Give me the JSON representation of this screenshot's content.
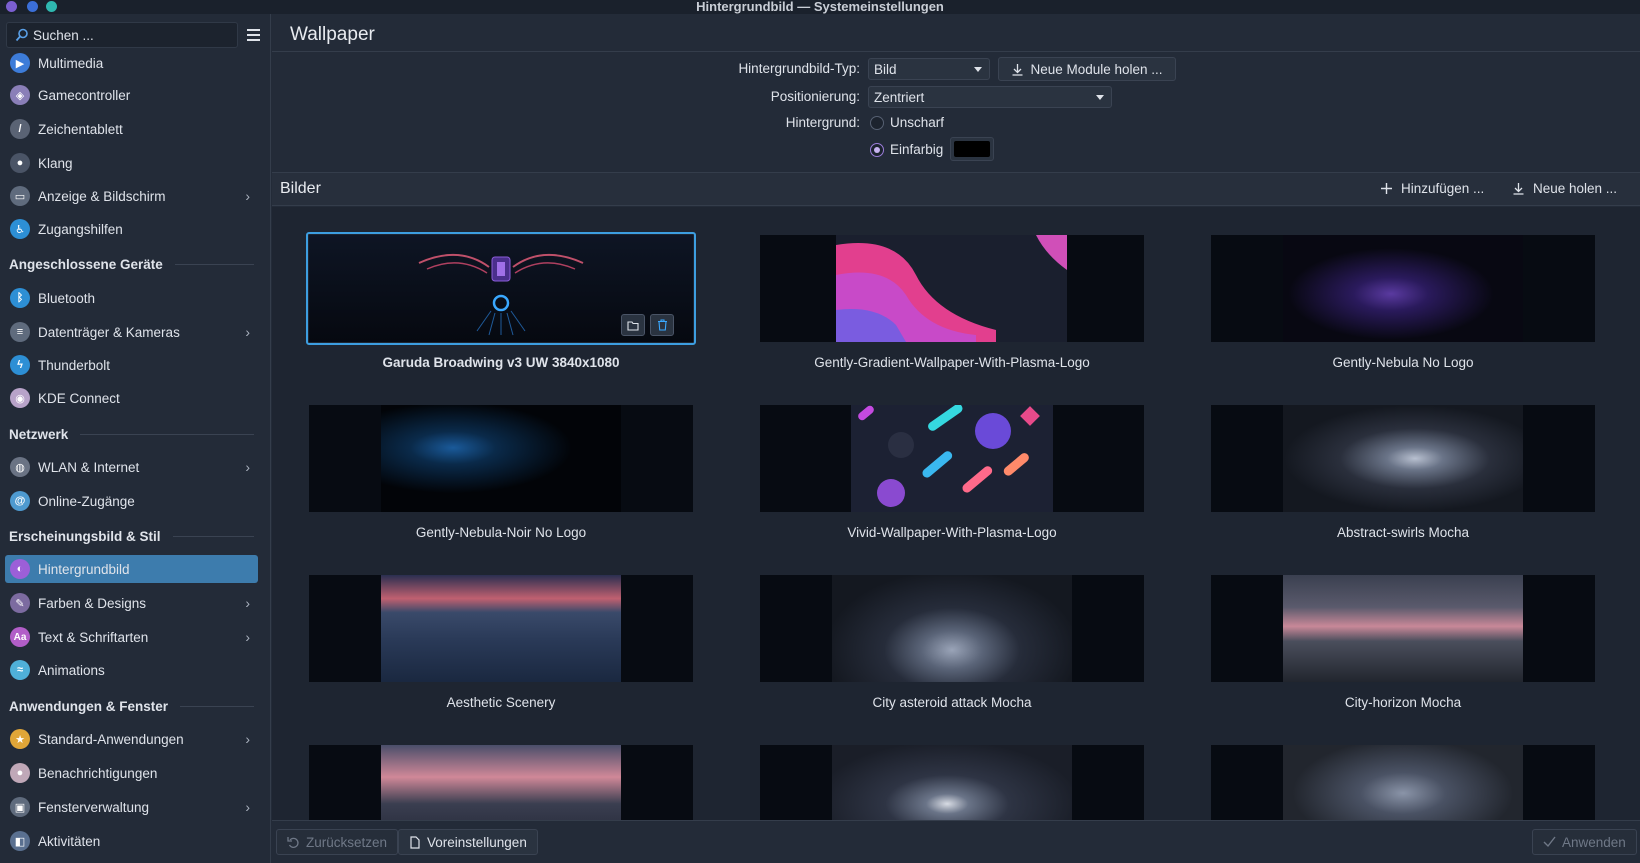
{
  "window": {
    "title": "Hintergrundbild — Systemeinstellungen"
  },
  "sidebar": {
    "search_placeholder": "Suchen ...",
    "items": [
      {
        "label": "Multimedia",
        "icon": "multimedia-icon",
        "color": "#3d7cd9"
      },
      {
        "label": "Gamecontroller",
        "icon": "gamecontroller-icon",
        "color": "#8a7fb8"
      },
      {
        "label": "Zeichentablett",
        "icon": "tablet-icon",
        "color": "#5a6374"
      },
      {
        "label": "Klang",
        "icon": "sound-icon",
        "color": "#4a5466"
      },
      {
        "label": "Anzeige & Bildschirm",
        "icon": "display-icon",
        "color": "#5f6b7d"
      },
      {
        "label": "Zugangshilfen",
        "icon": "accessibility-icon",
        "color": "#2d8fd5"
      }
    ],
    "section_devices": "Angeschlossene Geräte",
    "devices": [
      {
        "label": "Bluetooth",
        "icon": "bluetooth-icon",
        "color": "#2d8fd5"
      },
      {
        "label": "Datenträger & Kameras",
        "icon": "drive-icon",
        "color": "#5f6b7d"
      },
      {
        "label": "Thunderbolt",
        "icon": "thunderbolt-icon",
        "color": "#2d8fd5"
      },
      {
        "label": "KDE Connect",
        "icon": "kdeconnect-icon",
        "color": "#b8a3c9"
      }
    ],
    "section_network": "Netzwerk",
    "network": [
      {
        "label": "WLAN & Internet",
        "icon": "wlan-icon",
        "color": "#6a7384"
      },
      {
        "label": "Online-Zugänge",
        "icon": "online-accounts-icon",
        "color": "#4e9ad0"
      }
    ],
    "section_appearance": "Erscheinungsbild & Stil",
    "appearance": [
      {
        "label": "Hintergrundbild",
        "icon": "wallpaper-icon",
        "color": "#9c5fd8"
      },
      {
        "label": "Farben & Designs",
        "icon": "colors-icon",
        "color": "#7c6ba0"
      },
      {
        "label": "Text & Schriftarten",
        "icon": "fonts-icon",
        "color": "#b25ec8"
      },
      {
        "label": "Animations",
        "icon": "animations-icon",
        "color": "#4fb0d8"
      }
    ],
    "section_apps": "Anwendungen & Fenster",
    "apps": [
      {
        "label": "Standard-Anwendungen",
        "icon": "default-apps-icon",
        "color": "#e0a638"
      },
      {
        "label": "Benachrichtigungen",
        "icon": "notifications-icon",
        "color": "#c0a8b8"
      },
      {
        "label": "Fensterverwaltung",
        "icon": "window-management-icon",
        "color": "#5f6b7d"
      },
      {
        "label": "Aktivitäten",
        "icon": "activities-icon",
        "color": "#5a7090"
      }
    ]
  },
  "main": {
    "title": "Wallpaper",
    "type_label": "Hintergrundbild-Typ:",
    "type_value": "Bild",
    "new_modules": "Neue Module holen ...",
    "position_label": "Positionierung:",
    "position_value": "Zentriert",
    "background_label": "Hintergrund:",
    "option_blur": "Unscharf",
    "option_solid": "Einfarbig",
    "solid_color": "#000000"
  },
  "images": {
    "title": "Bilder",
    "add": "Hinzufügen ...",
    "get_new": "Neue holen ...",
    "tiles": [
      {
        "caption": "Garuda Broadwing v3 UW 3840x1080",
        "selected": true
      },
      {
        "caption": "Gently-Gradient-Wallpaper-With-Plasma-Logo",
        "selected": false
      },
      {
        "caption": "Gently-Nebula No Logo",
        "selected": false
      },
      {
        "caption": "Gently-Nebula-Noir No Logo",
        "selected": false
      },
      {
        "caption": "Vivid-Wallpaper-With-Plasma-Logo",
        "selected": false
      },
      {
        "caption": "Abstract-swirls Mocha",
        "selected": false
      },
      {
        "caption": "Aesthetic Scenery",
        "selected": false
      },
      {
        "caption": "City asteroid attack Mocha",
        "selected": false
      },
      {
        "caption": "City-horizon Mocha",
        "selected": false
      },
      {
        "caption": "",
        "selected": false
      },
      {
        "caption": "",
        "selected": false
      },
      {
        "caption": "",
        "selected": false
      }
    ]
  },
  "footer": {
    "reset": "Zurücksetzen",
    "defaults": "Voreinstellungen",
    "apply": "Anwenden"
  }
}
